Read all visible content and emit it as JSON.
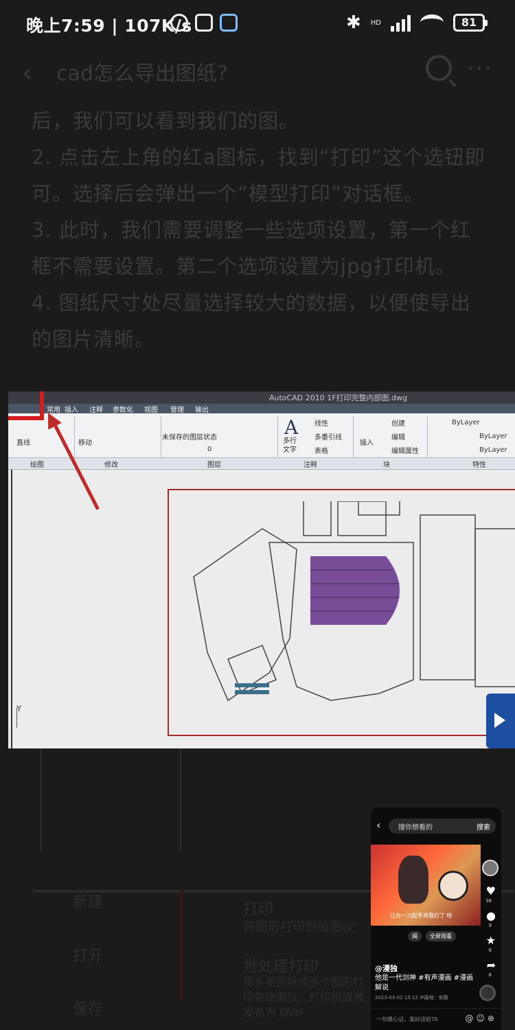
{
  "status_bar": {
    "time": "晚上7:59 | 107K/s",
    "battery": "81",
    "network": "HD"
  },
  "nav": {
    "back_icon": "chevron-left-icon",
    "title": "cad怎么导出图纸?",
    "search_icon": "search-icon",
    "more_icon": "more-icon"
  },
  "article": {
    "lines": [
      "后，我们可以看到我们的图。",
      "2. 点击左上角的红a图标，找到“打印”这个选钮即可。选择后会弹出一个“模型打印”对话框。",
      "3. 此时，我们需要调整一些选项设置，第一个红框不需要设置。第二个选项设置为jpg打印机。",
      "4. 图纸尺寸处尽量选择较大的数据，以便使导出的图片清晰。"
    ]
  },
  "cad_image": {
    "title": "AutoCAD 2010   1F打印完整内部图.dwg",
    "menus": [
      "常用",
      "插入",
      "注释",
      "参数化",
      "视图",
      "管理",
      "输出"
    ],
    "ribbon_labels": {
      "line": "直线",
      "move": "移动",
      "layer_state": "未保存的图层状态",
      "multiline_text": "多行文字",
      "linear": "线性",
      "multileader": "多重引线",
      "table": "表格",
      "insert": "插入",
      "create": "创建",
      "edit": "编辑",
      "edit_attr": "编辑属性",
      "bylayer1": "ByLayer",
      "bylayer2": "ByLayer",
      "bylayer3": "ByLayer",
      "layer_zero": "0"
    },
    "panels": [
      "绘图",
      "修改",
      "图层",
      "注释",
      "块",
      "特性"
    ],
    "y_axis": "Y"
  },
  "lower_ghost": {
    "items": [
      "新建",
      "打印",
      "将图形打印到绘图仪",
      "打开",
      "批处理打印",
      "将多张图纸或多个图形打印到绘图仪、打印机或者发布为 DWF",
      "保存"
    ]
  },
  "mini_window": {
    "back_icon": "chevron-left-icon",
    "search_placeholder": "搜你想看的",
    "search_button": "搜索",
    "subtitle": "让你一刀起手将我打了 哈",
    "like_count": "38",
    "comment_count": "9",
    "star_count": "8",
    "share_count": "8",
    "pill1": "揭",
    "pill2": "全屏观看",
    "author": "@漫独",
    "description": "他是一代剑神 #有声漫画 #漫画解说",
    "meta": "2023-03-02 15:12  IP属地：安徽",
    "comment_placeholder": "一句暖心话，美好送给TA"
  }
}
